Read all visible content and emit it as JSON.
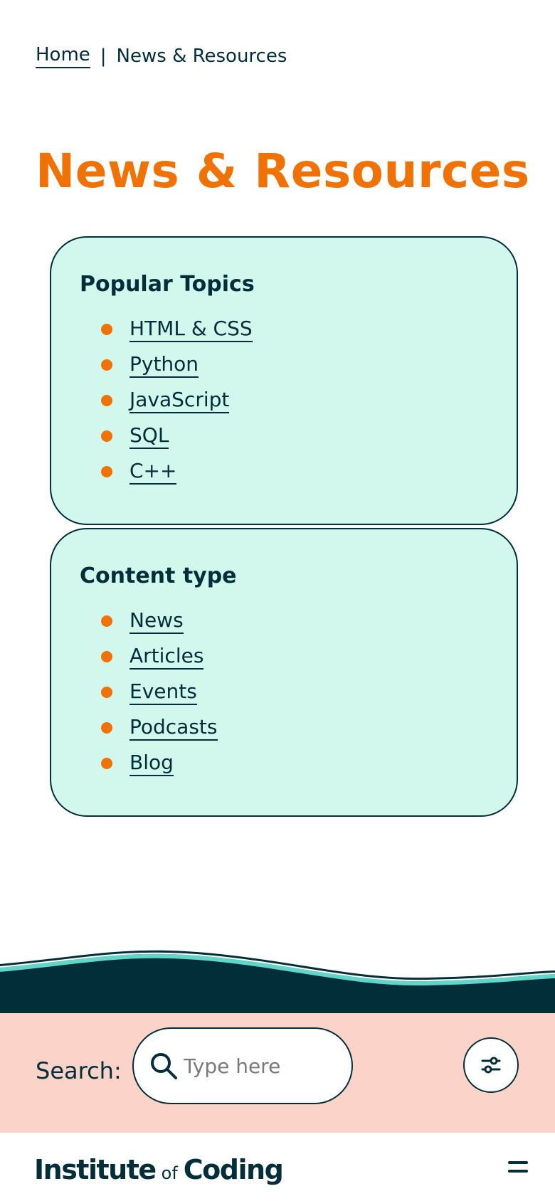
{
  "breadcrumb": {
    "home": "Home",
    "separator": "|",
    "current": "News & Resources"
  },
  "page": {
    "title": "News & Resources"
  },
  "popular_topics": {
    "heading": "Popular Topics",
    "items": [
      "HTML & CSS",
      "Python",
      "JavaScript",
      "SQL",
      "C++"
    ]
  },
  "content_type": {
    "heading": "Content type",
    "items": [
      "News",
      "Articles",
      "Events",
      "Podcasts",
      "Blog"
    ]
  },
  "search": {
    "label": "Search:",
    "placeholder": "Type here",
    "value": ""
  },
  "footer": {
    "logo_part1": "Institute",
    "logo_part2": "of",
    "logo_part3": "Coding"
  },
  "colors": {
    "accent": "#f07205",
    "dark": "#022e3a",
    "panel_bg": "#d2f7ec",
    "search_bg": "#fcd3c8",
    "wave_teal": "#5fd6c8"
  },
  "icons": {
    "search": "search-icon",
    "filter": "sliders-icon",
    "menu": "hamburger-menu-icon"
  }
}
